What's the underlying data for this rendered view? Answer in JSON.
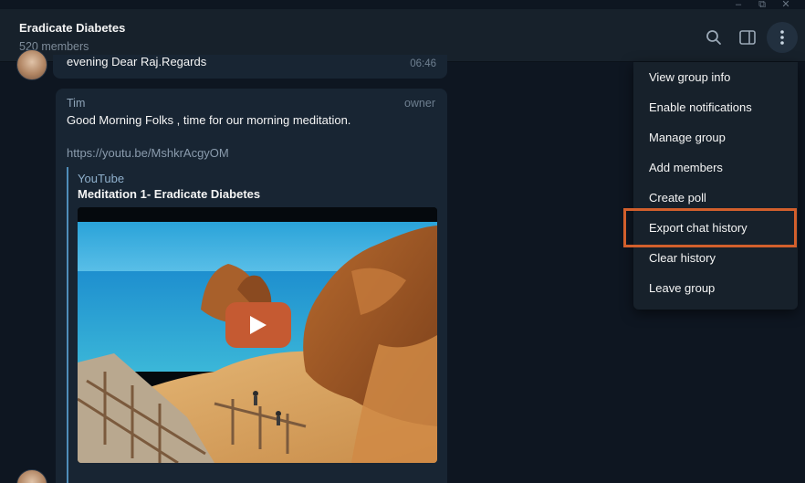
{
  "window_controls": {
    "minimize": "–",
    "restore": "⧉",
    "close": "✕"
  },
  "header": {
    "title": "Eradicate Diabetes",
    "members": "520 members"
  },
  "previous_message": {
    "text": "evening Dear Raj.Regards",
    "time": "06:46"
  },
  "message": {
    "sender": "Tim",
    "role": "owner",
    "text": "Good Morning Folks , time for our morning meditation.",
    "link": "https://youtu.be/MshkrAcgyOM",
    "preview": {
      "site": "YouTube",
      "title": "Meditation 1- Eradicate Diabetes"
    }
  },
  "menu": {
    "items": [
      {
        "label": "View group info"
      },
      {
        "label": "Enable notifications"
      },
      {
        "label": "Manage group"
      },
      {
        "label": "Add members"
      },
      {
        "label": "Create poll"
      },
      {
        "label": "Export chat history"
      },
      {
        "label": "Clear history"
      },
      {
        "label": "Leave group"
      }
    ],
    "highlighted_index": 5
  },
  "icons": {
    "search": "search-icon",
    "sidebar": "sidebar-toggle-icon",
    "more": "more-vertical-icon",
    "play": "play-icon"
  },
  "colors": {
    "background": "#0e1621",
    "header": "#17212b",
    "bubble": "#182533",
    "accent_highlight": "#d25f2c",
    "play_button": "#c55a32",
    "link": "#8a9bad"
  }
}
